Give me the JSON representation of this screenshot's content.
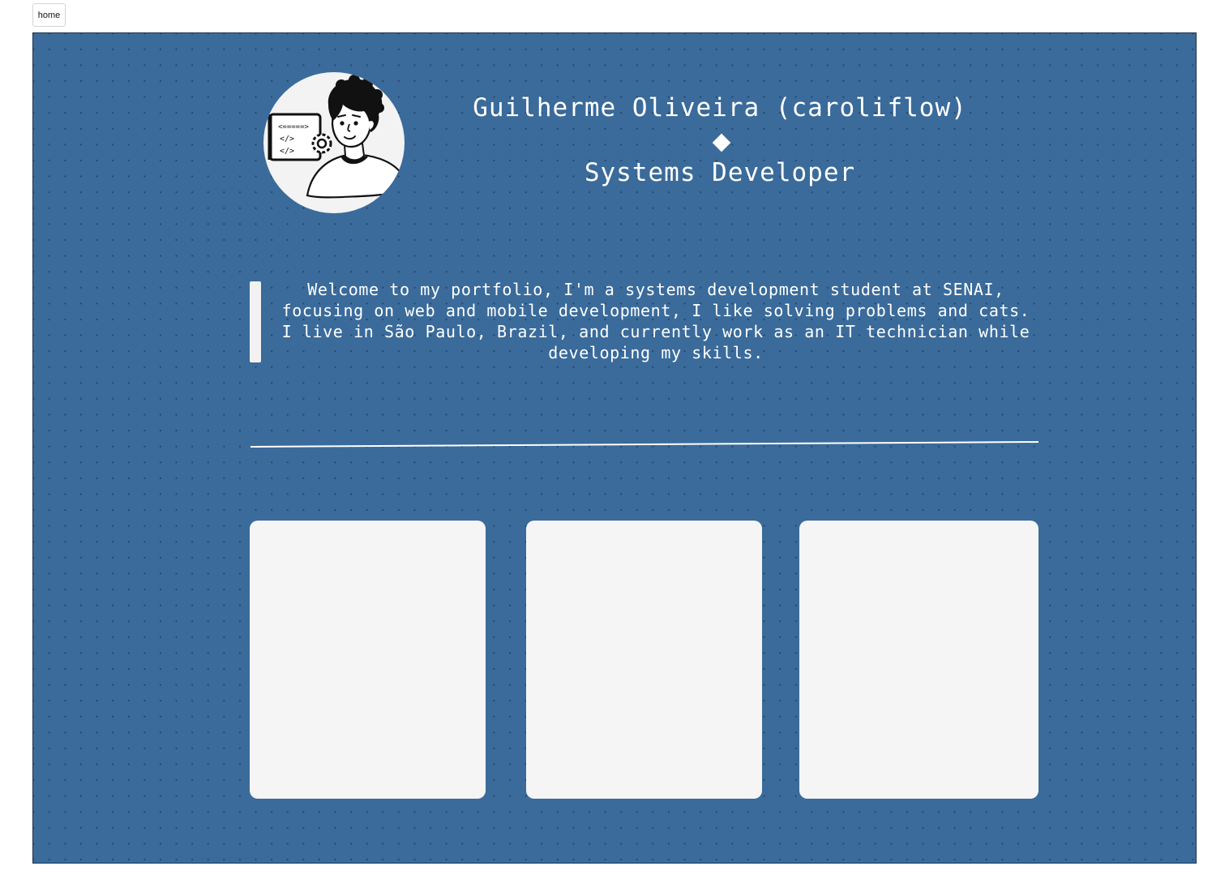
{
  "nav": {
    "home_label": "home"
  },
  "profile": {
    "name": "Guilherme Oliveira (caroliflow)",
    "role": "Systems Developer",
    "separator_icon": "diamond-icon",
    "avatar_icon": "developer-avatar-illustration"
  },
  "intro": {
    "text": "Welcome to my portfolio, I'm a systems development student at SENAI, focusing on web and mobile development, I like solving problems and cats. I live in São Paulo, Brazil, and currently work as an IT technician while developing my skills."
  },
  "cards": [
    {},
    {},
    {}
  ],
  "colors": {
    "panel_background": "#3a6b9b",
    "text": "#ffffff",
    "card_background": "#f5f5f5"
  }
}
